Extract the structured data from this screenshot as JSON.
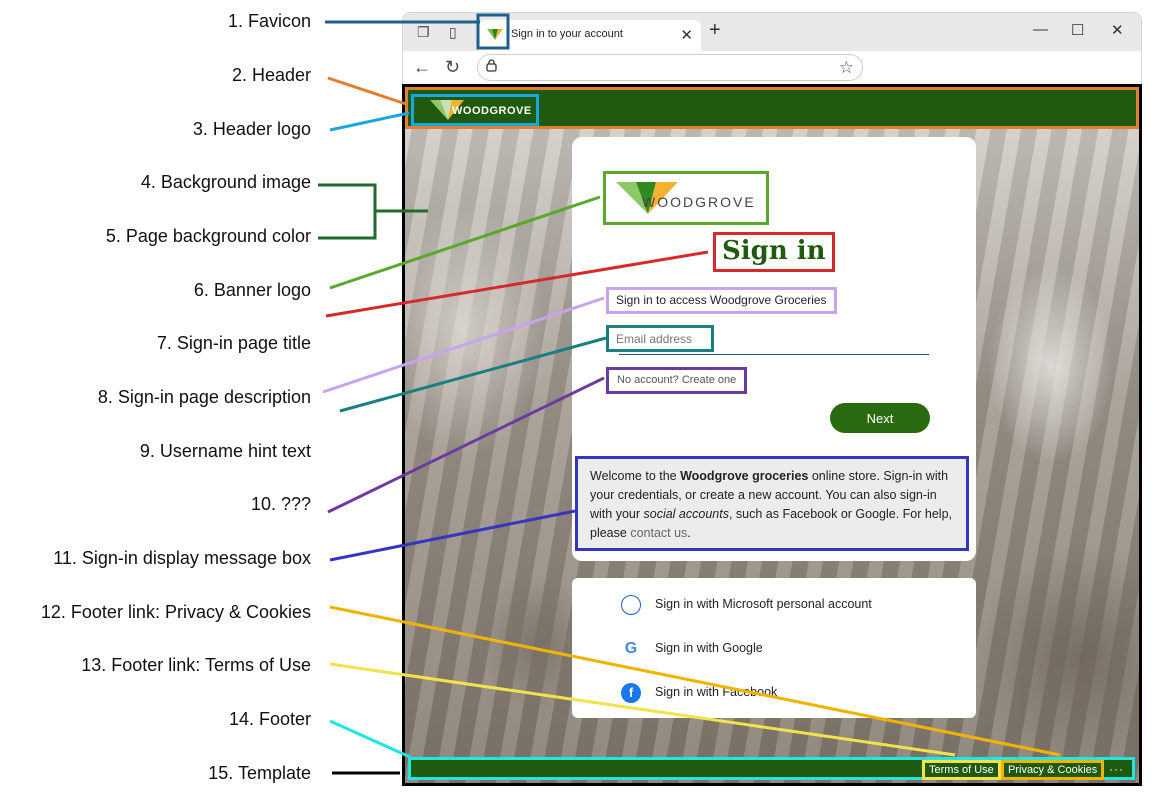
{
  "annotations": [
    "1. Favicon",
    "2. Header",
    "3. Header logo",
    "4. Background image",
    "5. Page background  color",
    "6. Banner logo",
    "7. Sign-in page title",
    "8. Sign-in page description",
    "9. Username hint text",
    "10. ???",
    "11. Sign-in display message box",
    "12. Footer link: Privacy & Cookies",
    "13. Footer link: Terms of Use",
    "14. Footer",
    "15. Template"
  ],
  "browser": {
    "tab_title": "Sign in to your account",
    "tab_close": "✕",
    "new_tab": "+"
  },
  "header": {
    "logo_text": "WOODGROVE"
  },
  "card": {
    "banner_text": "WOODGROVE",
    "title": "Sign in",
    "description": "Sign in to access Woodgrove Groceries",
    "email_placeholder": "Email address",
    "no_account": "No account? Create one",
    "next": "Next",
    "message": {
      "p1": "Welcome to the ",
      "bold": "Woodgrove groceries",
      "p2": " online store. Sign-in with your credentials, or create a new account. You can also sign-in with your ",
      "italic": "social accounts",
      "p3": ", such as Facebook or Google. For help, please ",
      "link": "contact us",
      "p4": "."
    }
  },
  "social": {
    "microsoft": "Sign in with Microsoft personal account",
    "google": "Sign in with Google",
    "facebook": "Sign in with Facebook"
  },
  "footer": {
    "terms": "Terms of Use",
    "privacy": "Privacy & Cookies",
    "more": "···"
  },
  "colors": {
    "brand_green": "#1f5a0e",
    "button_green": "#2a6b12",
    "title_green": "#1f5a0e"
  }
}
